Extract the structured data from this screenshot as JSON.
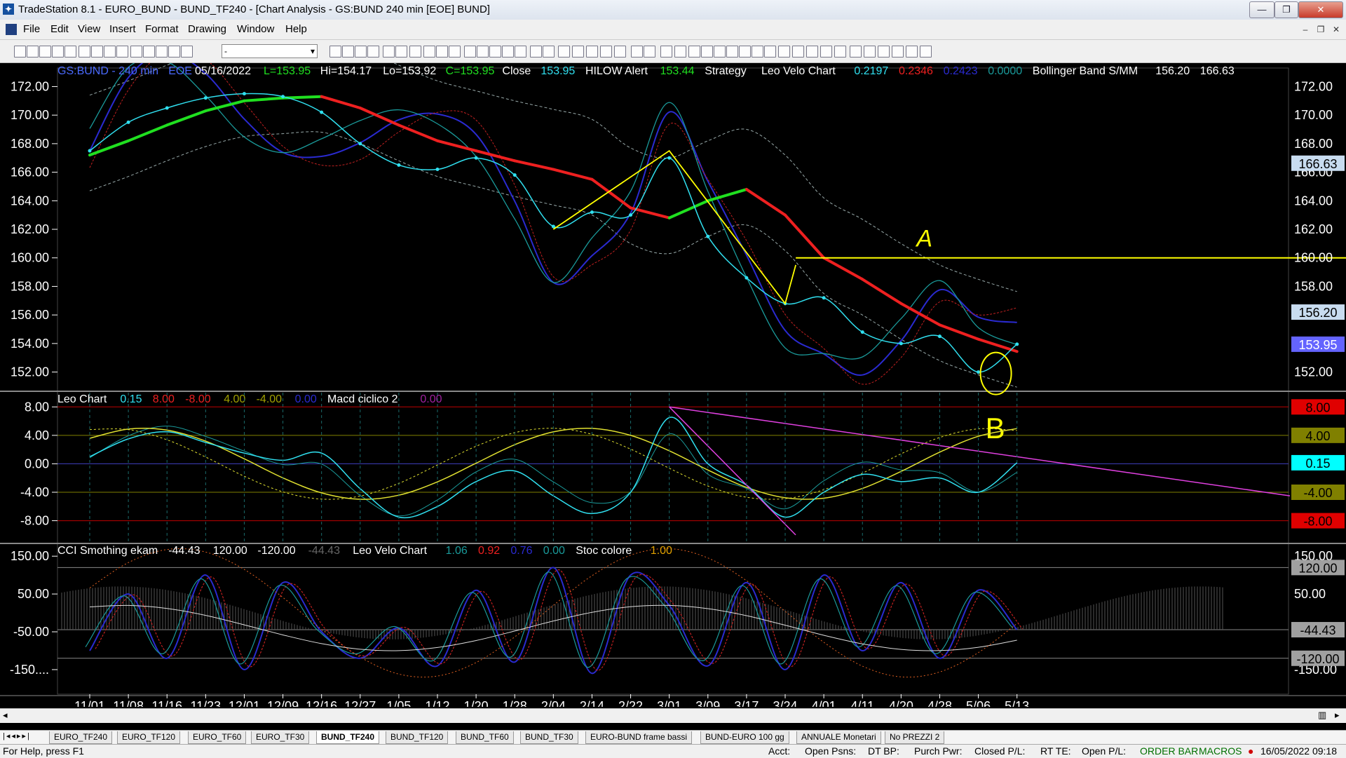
{
  "window": {
    "title": "TradeStation 8.1 - EURO_BUND - BUND_TF240 - [Chart Analysis - GS:BUND  240 min  [EOE] BUND]",
    "minimize_glyph": "—",
    "restore_glyph": "❐",
    "close_glyph": "✕",
    "mdi_minimize": "–",
    "mdi_restore": "❐",
    "mdi_close": "✕"
  },
  "menu": [
    "File",
    "Edit",
    "View",
    "Insert",
    "Format",
    "Drawing",
    "Window",
    "Help"
  ],
  "toolbar": {
    "combo_value": "-"
  },
  "panels": {
    "price": {
      "header": [
        "GS:BUND - 240 min",
        "EOE",
        "05/16/2022",
        "L=153.95",
        "Hi=154.17",
        "Lo=153.92",
        "C=153.95",
        "Close",
        "153.95",
        "HILOW Alert",
        "153.44",
        "Strategy",
        "Leo Velo Chart",
        "0.2197",
        "0.2346",
        "0.2423",
        "0.0000",
        "Bollinger Band S/MM",
        "156.20",
        "166.63"
      ],
      "ticks": [
        "172.00",
        "170.00",
        "168.00",
        "166.00",
        "164.00",
        "162.00",
        "160.00",
        "158.00",
        "156.00",
        "154.00",
        "152.00"
      ],
      "right_labels": [
        {
          "text": "172.00",
          "v": 172
        },
        {
          "text": "170.00",
          "v": 170
        },
        {
          "text": "168.00",
          "v": 168
        },
        {
          "text": "166.00",
          "v": 166
        },
        {
          "text": "164.00",
          "v": 164
        },
        {
          "text": "162.00",
          "v": 162
        },
        {
          "text": "160.00",
          "v": 160
        },
        {
          "text": "158.00",
          "v": 158
        },
        {
          "text": "152.00",
          "v": 152
        }
      ],
      "markers": [
        {
          "text": "166.63",
          "v": 166.63,
          "bg": "#c8dcf0",
          "fg": "#000"
        },
        {
          "text": "156.20",
          "v": 156.2,
          "bg": "#c8dcf0",
          "fg": "#000"
        },
        {
          "text": "153.95",
          "v": 153.95,
          "bg": "#6464ff",
          "fg": "#fff"
        }
      ],
      "hline": 160.0,
      "annotations": [
        "A",
        "B"
      ]
    },
    "leo": {
      "header": [
        "Leo Chart",
        "0.15",
        "8.00",
        "-8.00",
        "4.00",
        "-4.00",
        "0.00",
        "Macd ciclico 2",
        "0.00"
      ],
      "ticks": [
        "8.00",
        "4.00",
        "0.00",
        "-4.00",
        "-8.00"
      ],
      "markers": [
        {
          "text": "8.00",
          "v": 8,
          "bg": "#e00000",
          "fg": "#000"
        },
        {
          "text": "4.00",
          "v": 4,
          "bg": "#808000",
          "fg": "#000"
        },
        {
          "text": "0.15",
          "v": 0.15,
          "bg": "#00ffff",
          "fg": "#000"
        },
        {
          "text": "-4.00",
          "v": -4,
          "bg": "#808000",
          "fg": "#000"
        },
        {
          "text": "-8.00",
          "v": -8,
          "bg": "#e00000",
          "fg": "#000"
        }
      ]
    },
    "cci": {
      "header": [
        "CCI Smothing ekam",
        "-44.43",
        "120.00",
        "-120.00",
        "-44.43",
        "Leo Velo Chart",
        "1.06",
        "0.92",
        "0.76",
        "0.00",
        "Stoc colore",
        "1.00"
      ],
      "ticks": [
        "150.00",
        "50.00",
        "-50.00",
        "-150...."
      ],
      "right_labels": [
        {
          "text": "150.00",
          "v": 150
        },
        {
          "text": "50.00",
          "v": 50
        },
        {
          "text": "-150.00",
          "v": -150
        }
      ],
      "markers": [
        {
          "text": "120.00",
          "v": 120,
          "bg": "#a0a0a0",
          "fg": "#000"
        },
        {
          "text": "-44.43",
          "v": -44.43,
          "bg": "#a0a0a0",
          "fg": "#000"
        },
        {
          "text": "-120.00",
          "v": -120,
          "bg": "#a0a0a0",
          "fg": "#000"
        }
      ]
    }
  },
  "xaxis": [
    "11/01",
    "11/08",
    "11/16",
    "11/23",
    "12/01",
    "12/09",
    "12/16",
    "12/27",
    "1/05",
    "1/12",
    "1/20",
    "1/28",
    "2/04",
    "2/14",
    "2/22",
    "3/01",
    "3/09",
    "3/17",
    "3/24",
    "4/01",
    "4/11",
    "4/20",
    "4/28",
    "5/06",
    "5/13"
  ],
  "chart_data": {
    "type": "line",
    "symbol": "GS:BUND",
    "interval": "240 min",
    "x": [
      "11/01",
      "11/08",
      "11/16",
      "11/23",
      "12/01",
      "12/09",
      "12/16",
      "12/27",
      "1/05",
      "1/12",
      "1/20",
      "1/28",
      "2/04",
      "2/14",
      "2/22",
      "3/01",
      "3/09",
      "3/17",
      "3/24",
      "4/01",
      "4/11",
      "4/20",
      "4/28",
      "5/06",
      "5/13"
    ],
    "series": [
      {
        "values": [
          167.5,
          169.5,
          170.5,
          171.2,
          171.5,
          171.3,
          170.2,
          168.0,
          166.5,
          166.2,
          167.0,
          165.8,
          162.2,
          163.2,
          163.0,
          167.0,
          161.5,
          158.6,
          156.8,
          157.2,
          154.8,
          154.0,
          154.5,
          152.0,
          153.95
        ]
      },
      {
        "values": [
          167.2,
          168.2,
          169.3,
          170.3,
          171.0,
          171.2,
          171.3,
          170.5,
          169.3,
          168.2,
          167.5,
          166.8,
          166.2,
          165.5,
          163.5,
          162.8,
          164.0,
          164.8,
          163.0,
          160.0,
          158.5,
          156.8,
          155.3,
          154.3,
          153.44
        ]
      },
      {
        "values": [
          1.0,
          3.5,
          4.5,
          3.0,
          1.5,
          0.5,
          1.5,
          -3.5,
          -7.5,
          -6.0,
          -2.5,
          -1.0,
          -4.5,
          -7.0,
          -4.0,
          6.5,
          0.0,
          -3.0,
          -7.5,
          -4.0,
          -1.5,
          -2.5,
          -2.0,
          -4.0,
          0.15
        ]
      },
      {
        "values": [
          -100,
          50,
          -120,
          100,
          -150,
          80,
          -50,
          -120,
          -40,
          -140,
          60,
          -130,
          120,
          -160,
          100,
          20,
          -140,
          80,
          -150,
          100,
          -100,
          80,
          -120,
          60,
          -44.43
        ]
      }
    ],
    "ylim_price": [
      150.8,
      173.3
    ],
    "ylim_leo": [
      -11,
      10
    ],
    "ylim_cci": [
      -215,
      180
    ]
  },
  "tabs": [
    "EURO_TF240",
    "EURO_TF120",
    "EURO_TF60",
    "EURO_TF30",
    "BUND_TF240",
    "BUND_TF120",
    "BUND_TF60",
    "BUND_TF30",
    "EURO-BUND frame bassi",
    "BUND-EURO 100 gg",
    "ANNUALE Monetari",
    "No PREZZI 2"
  ],
  "active_tab": 4,
  "status": {
    "help": "For Help, press F1",
    "acct": "Acct:",
    "open_psns": "Open Psns:",
    "dt_bp": "DT BP:",
    "purch_pwr": "Purch Pwr:",
    "closed_pl": "Closed P/L:",
    "rt_te": "RT TE:",
    "open_pl": "Open P/L:",
    "order_bar": "ORDER BAR",
    "macros": "MACROS",
    "datetime": "16/05/2022 09:18"
  }
}
